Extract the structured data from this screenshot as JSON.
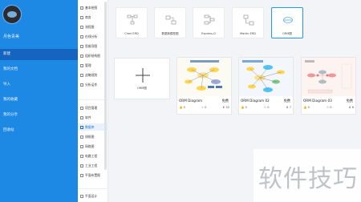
{
  "user": {
    "name": "月色青美"
  },
  "nav": {
    "items": [
      {
        "label": "新建",
        "active": true
      },
      {
        "label": "我的文档",
        "active": false
      },
      {
        "label": "导入",
        "active": false
      },
      {
        "label": "我的收藏",
        "active": false
      },
      {
        "label": "我的分享",
        "active": false
      },
      {
        "label": "回收站",
        "active": false
      }
    ]
  },
  "categories": [
    {
      "label": "基本绘图",
      "active": false
    },
    {
      "label": "商务",
      "active": false
    },
    {
      "label": "流程图",
      "active": false
    },
    {
      "label": "在线分析",
      "active": false
    },
    {
      "label": "思维导图",
      "active": false
    },
    {
      "label": "组织结构图",
      "active": false
    },
    {
      "label": "管理",
      "active": false
    },
    {
      "label": "战略规划",
      "active": false
    },
    {
      "label": "分析运作",
      "active": false
    },
    {
      "label": "项目管理",
      "active": false
    },
    {
      "label": "软件",
      "active": false
    },
    {
      "label": "数据库",
      "active": true
    },
    {
      "label": "线框图",
      "active": false
    },
    {
      "label": "网络图",
      "active": false
    },
    {
      "label": "电路工程",
      "active": false
    },
    {
      "label": "工业工程",
      "active": false
    },
    {
      "label": "平面布置图",
      "active": false
    },
    {
      "label": "平面设计",
      "active": false
    }
  ],
  "templates": [
    {
      "label": "Chen ERD",
      "active": false
    },
    {
      "label": "数据库模型图",
      "active": false
    },
    {
      "label": "Express-G",
      "active": false
    },
    {
      "label": "Martin ERD",
      "active": false
    },
    {
      "label": "ORM图",
      "active": true
    }
  ],
  "blank_card": {
    "label": "ORM图"
  },
  "diagrams": [
    {
      "title": "ORM Diagram",
      "price": "免费",
      "likes": "0",
      "favorites": "0",
      "downloads": "32"
    },
    {
      "title": "ORM Diagram 02",
      "price": "免费",
      "likes": "0",
      "favorites": "0",
      "downloads": "7"
    },
    {
      "title": "ORM Diagram 03",
      "price": "免费",
      "likes": "0",
      "favorites": "0",
      "downloads": "6"
    }
  ],
  "watermark": "软件技巧",
  "colors": {
    "nav_bg": "#1e88e5",
    "nav_active": "#1565c0",
    "accent": "#2196f3"
  }
}
